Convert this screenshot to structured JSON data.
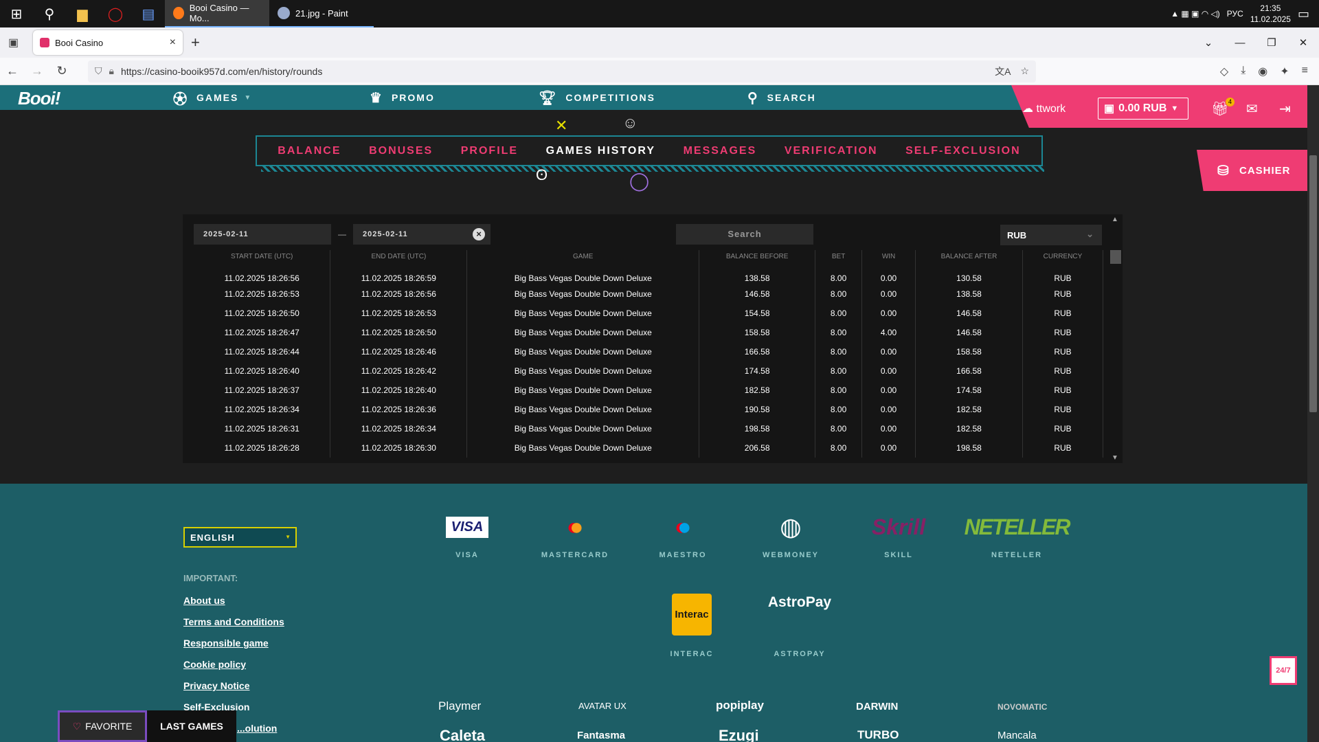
{
  "taskbar": {
    "apps": [
      {
        "label": "Booi Casino — Mo..."
      },
      {
        "label": "21.jpg - Paint"
      }
    ],
    "lang": "РУС",
    "time": "21:35",
    "date": "11.02.2025"
  },
  "browser": {
    "tab_title": "Booi Casino",
    "url": "https://casino-booik957d.com/en/history/rounds"
  },
  "site": {
    "logo": "Booi!",
    "nav": [
      "GAMES",
      "PROMO",
      "COMPETITIONS",
      "SEARCH"
    ],
    "username": "ttwork",
    "balance": "0.00 RUB",
    "gift_badge": "4",
    "cashier": "CASHIER",
    "subnav": [
      "BALANCE",
      "BONUSES",
      "PROFILE",
      "GAMES HISTORY",
      "MESSAGES",
      "VERIFICATION",
      "SELF-EXCLUSION"
    ],
    "active_subnav": "GAMES HISTORY"
  },
  "history": {
    "start_date": "2025-02-11",
    "end_date": "2025-02-11",
    "search_placeholder": "Search",
    "currency": "RUB",
    "columns": [
      "START DATE (UTC)",
      "END DATE (UTC)",
      "GAME",
      "BALANCE BEFORE",
      "BET",
      "WIN",
      "BALANCE AFTER",
      "CURRENCY"
    ],
    "rows": [
      [
        "11.02.2025 18:26:56",
        "11.02.2025 18:26:59",
        "Big Bass Vegas Double Down Deluxe",
        "138.58",
        "8.00",
        "0.00",
        "130.58",
        "RUB"
      ],
      [
        "11.02.2025 18:26:53",
        "11.02.2025 18:26:56",
        "Big Bass Vegas Double Down Deluxe",
        "146.58",
        "8.00",
        "0.00",
        "138.58",
        "RUB"
      ],
      [
        "11.02.2025 18:26:50",
        "11.02.2025 18:26:53",
        "Big Bass Vegas Double Down Deluxe",
        "154.58",
        "8.00",
        "0.00",
        "146.58",
        "RUB"
      ],
      [
        "11.02.2025 18:26:47",
        "11.02.2025 18:26:50",
        "Big Bass Vegas Double Down Deluxe",
        "158.58",
        "8.00",
        "4.00",
        "146.58",
        "RUB"
      ],
      [
        "11.02.2025 18:26:44",
        "11.02.2025 18:26:46",
        "Big Bass Vegas Double Down Deluxe",
        "166.58",
        "8.00",
        "0.00",
        "158.58",
        "RUB"
      ],
      [
        "11.02.2025 18:26:40",
        "11.02.2025 18:26:42",
        "Big Bass Vegas Double Down Deluxe",
        "174.58",
        "8.00",
        "0.00",
        "166.58",
        "RUB"
      ],
      [
        "11.02.2025 18:26:37",
        "11.02.2025 18:26:40",
        "Big Bass Vegas Double Down Deluxe",
        "182.58",
        "8.00",
        "0.00",
        "174.58",
        "RUB"
      ],
      [
        "11.02.2025 18:26:34",
        "11.02.2025 18:26:36",
        "Big Bass Vegas Double Down Deluxe",
        "190.58",
        "8.00",
        "0.00",
        "182.58",
        "RUB"
      ],
      [
        "11.02.2025 18:26:31",
        "11.02.2025 18:26:34",
        "Big Bass Vegas Double Down Deluxe",
        "198.58",
        "8.00",
        "0.00",
        "182.58",
        "RUB"
      ],
      [
        "11.02.2025 18:26:28",
        "11.02.2025 18:26:30",
        "Big Bass Vegas Double Down Deluxe",
        "206.58",
        "8.00",
        "0.00",
        "198.58",
        "RUB"
      ]
    ]
  },
  "footer": {
    "language": "ENGLISH",
    "important": "IMPORTANT:",
    "links": [
      "About us",
      "Terms and Conditions",
      "Responsible game",
      "Cookie policy",
      "Privacy Notice",
      "Self-Exclusion",
      "...olution"
    ],
    "payments": [
      "VISA",
      "MASTERCARD",
      "MAESTRO",
      "WEBMONEY",
      "SKILL",
      "NETELLER",
      "INTERAC",
      "ASTROPAY"
    ],
    "payment_logos": {
      "visa": "VISA",
      "skrill": "Skrill",
      "neteller": "NETELLER",
      "interac": "Interac",
      "astropay": "AstroPay"
    },
    "providers": [
      "Playmer",
      "AVATAR UX",
      "popiplay",
      "DARWIN",
      "NOVOMATIC",
      "Caleta",
      "Fantasma",
      "Ezugi",
      "TURBO",
      "Mancala"
    ],
    "favorite": "FAVORITE",
    "last_games": "LAST GAMES",
    "chat": "24/7"
  },
  "colors": {
    "accent": "#ef3c73",
    "teal": "#1c6f7a",
    "footer": "#1d5e66"
  }
}
